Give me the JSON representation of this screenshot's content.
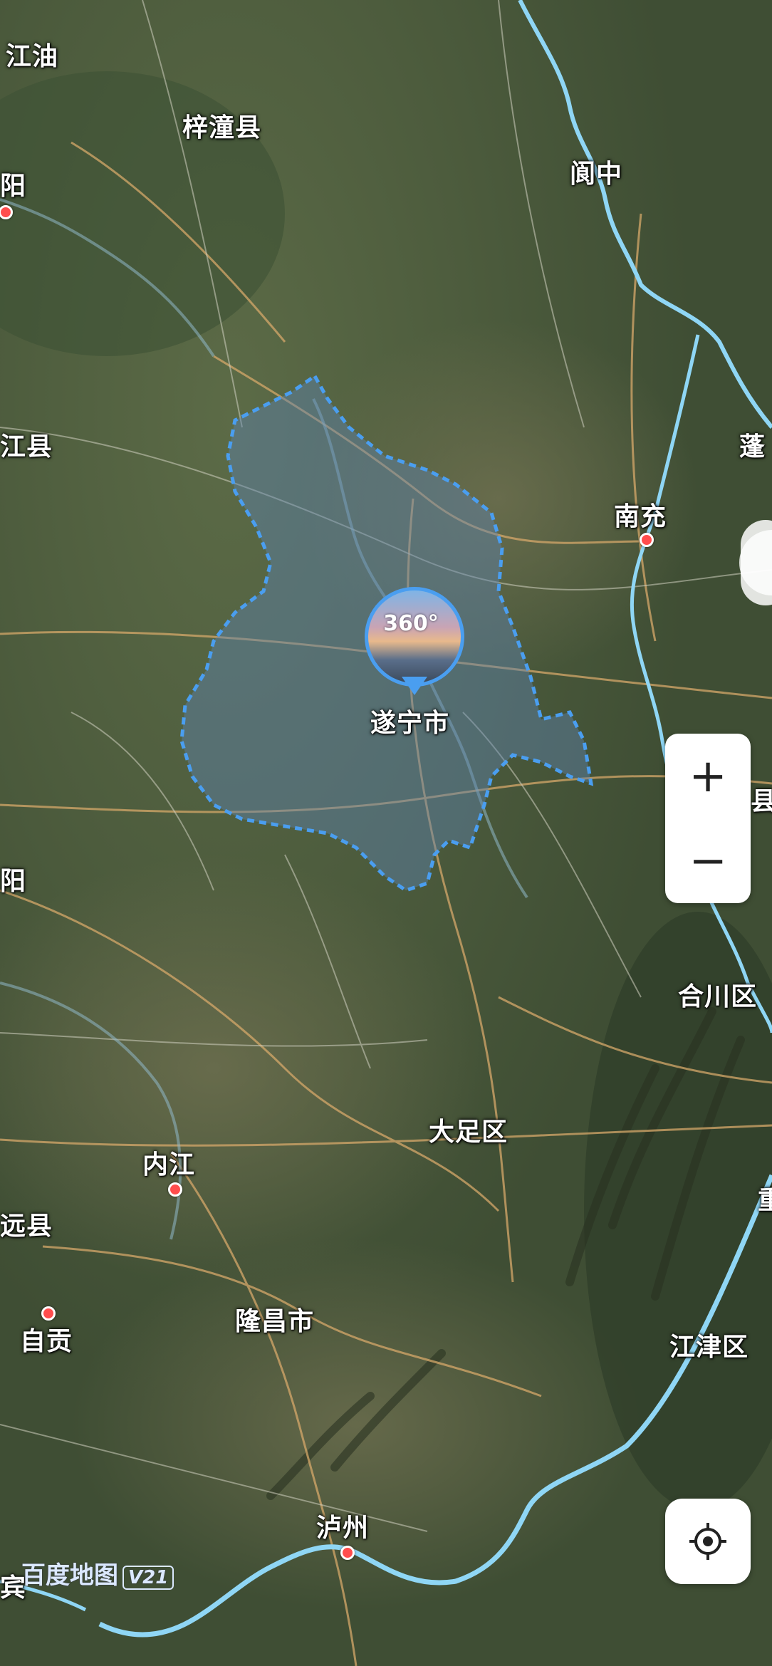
{
  "map": {
    "city_polygon_color": "#4a9ef0",
    "river_color": "#8fd6f5",
    "road_color": "#d6a86a"
  },
  "places": {
    "jiangyou": "江油",
    "zitong": "梓潼县",
    "mianyang": "阳",
    "langzhong": "阆中",
    "jiangxian": "江县",
    "peng": "蓬",
    "nanchong": "南充",
    "suining": "遂宁市",
    "county_right": "县",
    "yang_left": "阳",
    "hechuan": "合川区",
    "dazu": "大足区",
    "neijiang": "内江",
    "yuanxian": "远县",
    "zigong": "自贡",
    "longchang": "隆昌市",
    "jiangjin": "江津区",
    "luzhou": "泸州",
    "yibin_partial": "宾",
    "right_edge": "重"
  },
  "pin": {
    "label": "360°"
  },
  "controls": {
    "zoom_in": "+",
    "zoom_out": "−"
  },
  "logo": {
    "name": "百度地图",
    "version": "V21"
  },
  "icons": {
    "locate": "locate-crosshair-icon",
    "zoom_in": "plus-icon",
    "zoom_out": "minus-icon"
  }
}
